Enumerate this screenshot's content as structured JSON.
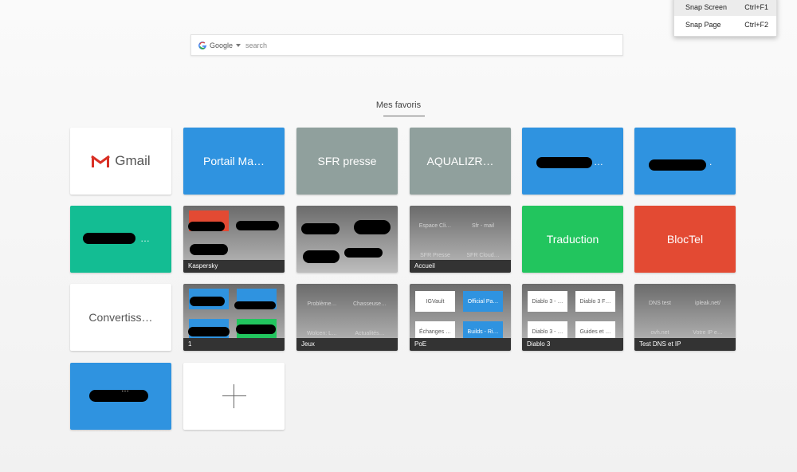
{
  "context_menu": {
    "items": [
      {
        "label": "Snap Screen",
        "shortcut": "Ctrl+F1"
      },
      {
        "label": "Snap Page",
        "shortcut": "Ctrl+F2"
      }
    ]
  },
  "search": {
    "engine": "Google",
    "placeholder": "search",
    "value": ""
  },
  "section_title": "Mes favoris",
  "tiles": {
    "gmail": "Gmail",
    "portail": "Portail Ma…",
    "sfr_presse": "SFR presse",
    "aqualizr": "AQUALIZR…",
    "redacted_blue_1": "…",
    "redacted_blue_2": ".",
    "redacted_teal": "…",
    "kaspersky": {
      "label": "Kaspersky"
    },
    "folder_2": {
      "label": ""
    },
    "accueil": {
      "label": "Accueil",
      "items": [
        "Espace Cli…",
        "Sfr - mail",
        "SFR Presse",
        "SFR Cloud…"
      ]
    },
    "traduction": "Traduction",
    "bloctel": "BlocTel",
    "convertiss": "Convertiss…",
    "folder_1": {
      "label": "1"
    },
    "jeux": {
      "label": "Jeux",
      "items": [
        "Problème…",
        "Chasseuse…",
        "Wolcen: L…",
        "Actualités…"
      ]
    },
    "poe": {
      "label": "PoE",
      "items": [
        "IGVault",
        "Official Pa…",
        "Échanges …",
        "Builds - Ri…"
      ]
    },
    "diablo": {
      "label": "Diablo 3",
      "items": [
        "Diablo 3 - …",
        "Diablo 3 F…",
        "Diablo 3 - …",
        "Guides et …"
      ]
    },
    "dns": {
      "label": "Test DNS et IP",
      "items": [
        "DNS test",
        "ipleak.net/",
        "ovh.net",
        "Votre IP e…"
      ]
    },
    "redacted_blue_3": "…"
  },
  "colors": {
    "blue": "#2f93e0",
    "gray": "#90a09d",
    "teal": "#13bd93",
    "green": "#22c55e",
    "red": "#e34a33",
    "folder_bar": "#333333"
  }
}
